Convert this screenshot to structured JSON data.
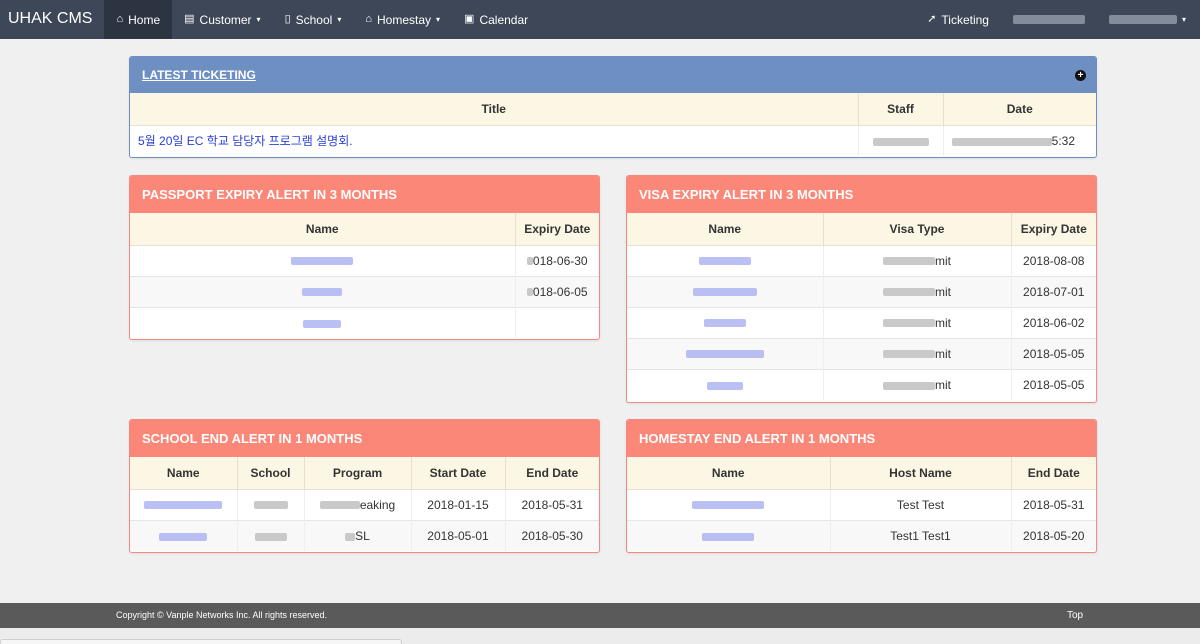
{
  "nav": {
    "brand": "UHAK CMS",
    "home": "Home",
    "customer": "Customer",
    "school": "School",
    "homestay": "Homestay",
    "calendar": "Calendar",
    "ticketing": "Ticketing",
    "caret": "▾",
    "home_icon": "⌂",
    "customer_icon": "▤",
    "school_icon": "▯",
    "homestay_icon": "⌂",
    "calendar_icon": "▣",
    "ticketing_icon": "➚"
  },
  "latest": {
    "title": "LATEST TICKETING",
    "plus": "+",
    "headers": [
      "Title",
      "Staff",
      "Date"
    ],
    "row": {
      "title": "5월 20일 EC 학교 담당자 프로그램 설명회.",
      "date_suffix": "5:32"
    }
  },
  "passport": {
    "title": "PASSPORT EXPIRY ALERT IN 3 MONTHS",
    "headers": [
      "Name",
      "Expiry Date"
    ],
    "rows": [
      {
        "date": "018-06-30"
      },
      {
        "date": "018-06-05"
      },
      {
        "date": ""
      }
    ]
  },
  "visa": {
    "title": "VISA EXPIRY ALERT IN 3 MONTHS",
    "headers": [
      "Name",
      "Visa Type",
      "Expiry Date"
    ],
    "rows": [
      {
        "type": "mit",
        "date": "2018-08-08"
      },
      {
        "type": "mit",
        "date": "2018-07-01"
      },
      {
        "type": "mit",
        "date": "2018-06-02"
      },
      {
        "type": "mit",
        "date": "2018-05-05"
      },
      {
        "type": "mit",
        "date": "2018-05-05"
      }
    ]
  },
  "school_end": {
    "title": "SCHOOL END ALERT IN 1 MONTHS",
    "headers": [
      "Name",
      "School",
      "Program",
      "Start Date",
      "End Date"
    ],
    "rows": [
      {
        "program": "eaking",
        "start": "2018-01-15",
        "end": "2018-05-31"
      },
      {
        "program": "SL",
        "start": "2018-05-01",
        "end": "2018-05-30"
      }
    ]
  },
  "homestay_end": {
    "title": "HOMESTAY END ALERT IN 1 MONTHS",
    "headers": [
      "Name",
      "Host Name",
      "End Date"
    ],
    "rows": [
      {
        "host": "Test Test",
        "end": "2018-05-31"
      },
      {
        "host": "Test1 Test1",
        "end": "2018-05-20"
      }
    ]
  },
  "footer": {
    "copyright": "Copyright © Vanple Networks Inc. All rights reserved.",
    "top": "Top"
  },
  "colors": {
    "navbar": "#3d4758",
    "alert_header": "#fa8778",
    "ticket_header": "#6e8fc2",
    "table_header": "#fcf7e4",
    "link": "#2a3fd4"
  }
}
